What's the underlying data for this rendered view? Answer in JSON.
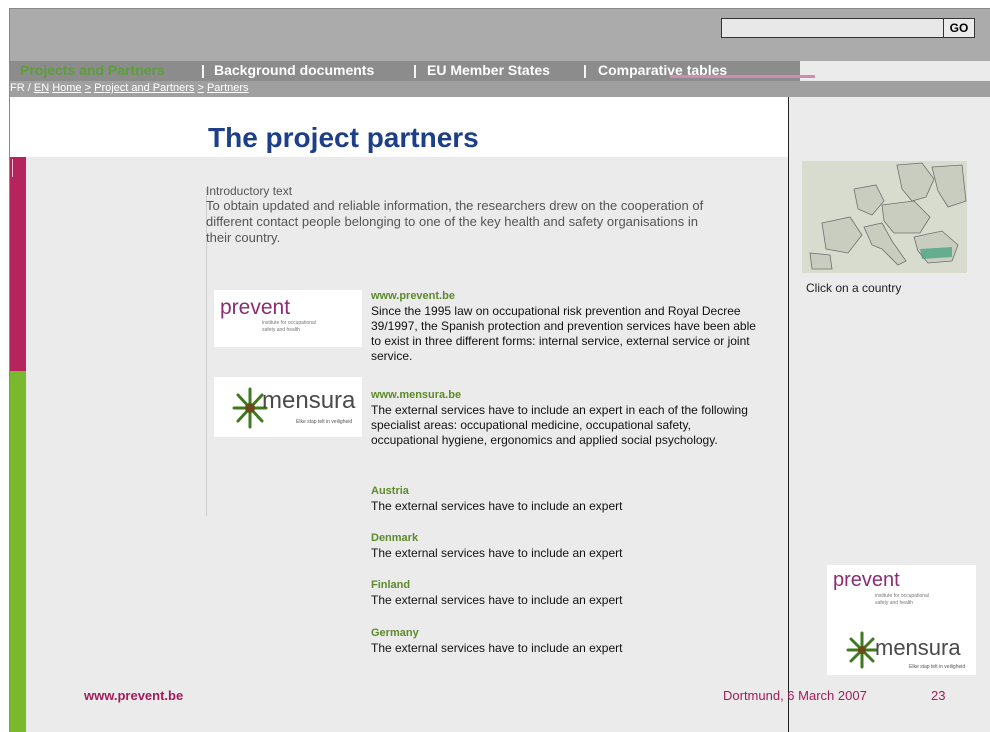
{
  "header": {
    "search_placeholder": "",
    "go_label": "GO"
  },
  "nav": {
    "item1": "Projects and Partners",
    "sep1": "|",
    "item2": "Background documents",
    "sep2": "|",
    "item3": "EU Member States",
    "sep3": "|",
    "item4": "Comparative tables"
  },
  "breadcrumb": {
    "lang_fr": "FR",
    "slash": "/",
    "lang_en": "EN",
    "home": "Home",
    "sep1": ">",
    "projects": "Project and Partners",
    "sep2": ">",
    "current": "Partners"
  },
  "page": {
    "title": "The project partners",
    "intro_label": "Introductory text",
    "intro_text": "To obtain updated and reliable information, the researchers drew on the cooperation of different contact people belonging to one of the key health and safety organisations in their country."
  },
  "logos": {
    "prevent_word": "prevent",
    "prevent_tagline": "institute for occupational safety and health",
    "mensura_word": "mensura",
    "mensura_tagline": "Elke stap telt in veiligheid"
  },
  "partners": [
    {
      "head": "www.prevent.be",
      "text": "Since the 1995 law on occupational risk prevention and Royal Decree 39/1997, the Spanish protection and prevention services have been able to exist in three different forms: internal service, external service or joint service."
    },
    {
      "head": "www.mensura.be",
      "text": "The external services have to include an expert in each of the following specialist areas: occupational medicine, occupational safety, occupational hygiene, ergonomics and applied social psychology."
    },
    {
      "head": "Austria",
      "text": "The external services have to include an expert"
    },
    {
      "head": "Denmark",
      "text": "The external services have to include an expert"
    },
    {
      "head": "Finland",
      "text": "The external services have to include an expert"
    },
    {
      "head": "Germany",
      "text": "The external services have to include an expert"
    }
  ],
  "sidebar": {
    "map_caption": "Click on a country"
  },
  "footer": {
    "url": "www.prevent.be",
    "date": "Dortmund, 6 March 2007",
    "page": "23"
  },
  "colors": {
    "title": "#1c3f87",
    "accent_pink": "#b5245c",
    "accent_green": "#7ab82e",
    "nav_active": "#5d9e3b"
  }
}
